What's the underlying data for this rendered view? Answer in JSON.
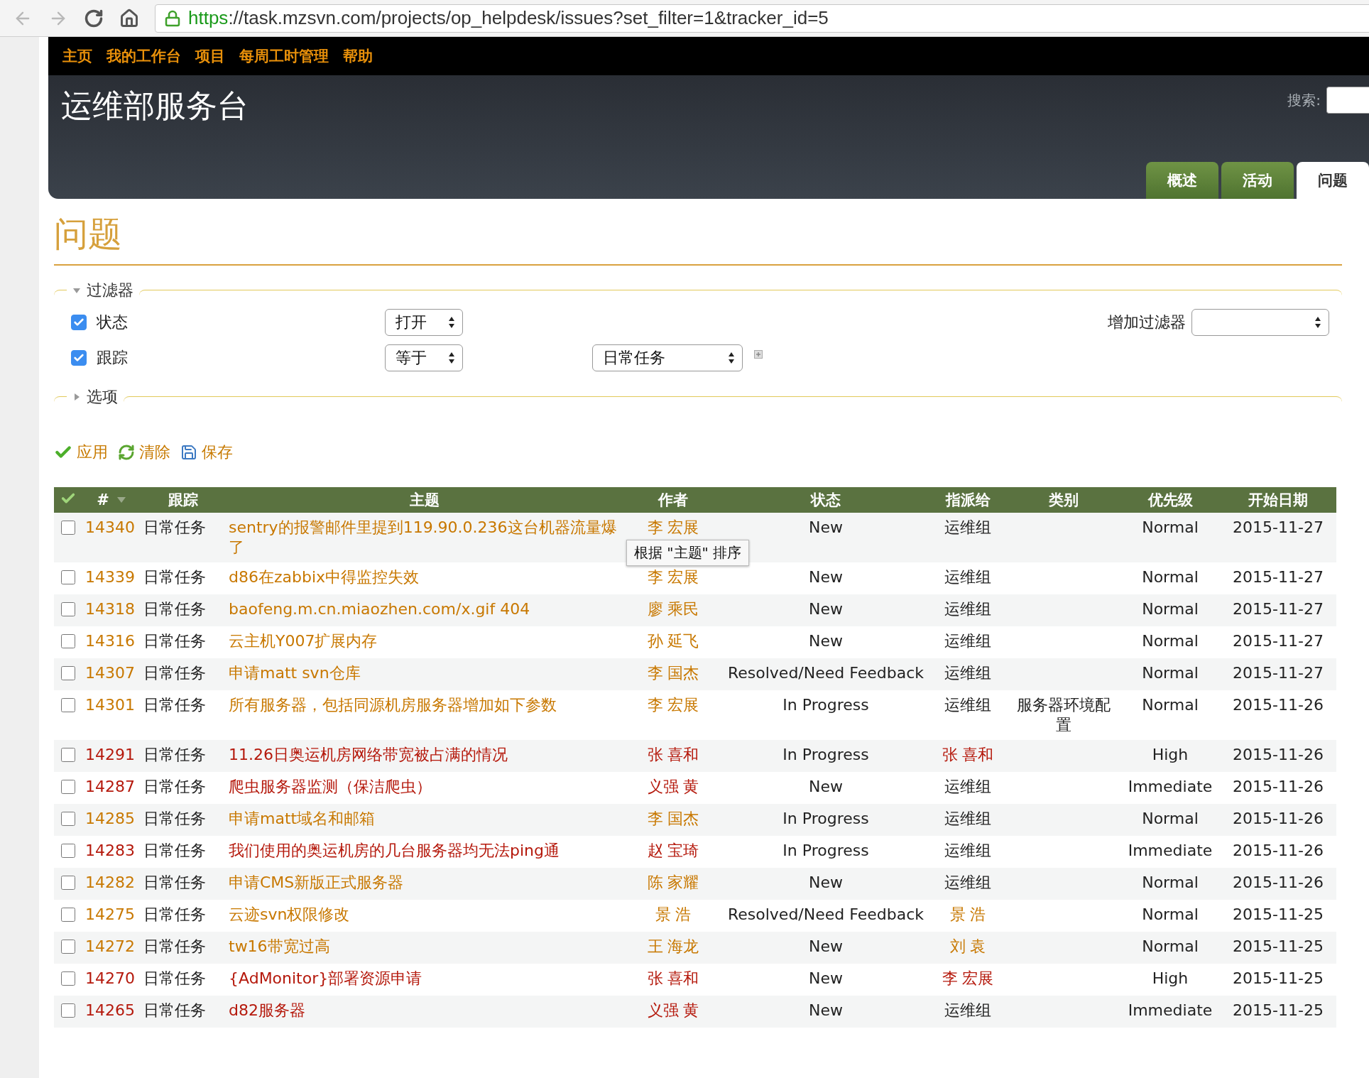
{
  "browser": {
    "url_scheme": "https",
    "url_rest": "://task.mzsvn.com/projects/op_helpdesk/issues?set_filter=1&tracker_id=5"
  },
  "top_menu": [
    "主页",
    "我的工作台",
    "项目",
    "每周工时管理",
    "帮助"
  ],
  "header": {
    "title": "运维部服务台",
    "search_label": "搜索:"
  },
  "tabs": [
    {
      "label": "概述",
      "selected": false
    },
    {
      "label": "活动",
      "selected": false
    },
    {
      "label": "问题",
      "selected": true
    }
  ],
  "page_title": "问题",
  "filters_legend": "过滤器",
  "filters_expanded": true,
  "filters": [
    {
      "label": "状态",
      "checked": true,
      "operator": "打开"
    },
    {
      "label": "跟踪",
      "checked": true,
      "operator": "等于",
      "value": "日常任务"
    }
  ],
  "add_filter_label": "增加过滤器",
  "options_legend": "选项",
  "options_expanded": false,
  "actions": [
    {
      "kind": "apply",
      "label": "应用"
    },
    {
      "kind": "clear",
      "label": "清除"
    },
    {
      "kind": "save",
      "label": "保存"
    }
  ],
  "table": {
    "columns": [
      "#",
      "跟踪",
      "主题",
      "作者",
      "状态",
      "指派给",
      "类别",
      "优先级",
      "开始日期"
    ],
    "rows": [
      {
        "id": "14340",
        "tracker": "日常任务",
        "subject": "sentry的报警邮件里提到119.90.0.236这台机器流量爆了",
        "author": "李 宏展",
        "status": "New",
        "assignee": "运维组",
        "assignee_link": false,
        "priority": "Normal",
        "urgent": false,
        "start": "2015-11-27",
        "checked": false
      },
      {
        "id": "14339",
        "tracker": "日常任务",
        "subject": "d86在zabbix中得监控失效",
        "author": "李 宏展",
        "status": "New",
        "assignee": "运维组",
        "assignee_link": false,
        "priority": "Normal",
        "urgent": false,
        "start": "2015-11-27",
        "checked": false
      },
      {
        "id": "14318",
        "tracker": "日常任务",
        "subject": "baofeng.m.cn.miaozhen.com/x.gif 404",
        "author": "廖 乘民",
        "status": "New",
        "assignee": "运维组",
        "assignee_link": false,
        "priority": "Normal",
        "urgent": false,
        "start": "2015-11-27",
        "checked": false
      },
      {
        "id": "14316",
        "tracker": "日常任务",
        "subject": "云主机Y007扩展内存",
        "author": "孙 延飞",
        "status": "New",
        "assignee": "运维组",
        "assignee_link": false,
        "priority": "Normal",
        "urgent": false,
        "start": "2015-11-27",
        "checked": false
      },
      {
        "id": "14307",
        "tracker": "日常任务",
        "subject": "申请matt svn仓库",
        "author": "李 国杰",
        "status": "Resolved/Need Feedback",
        "assignee": "运维组",
        "assignee_link": false,
        "priority": "Normal",
        "urgent": false,
        "start": "2015-11-27",
        "checked": false
      },
      {
        "id": "14301",
        "tracker": "日常任务",
        "subject": "所有服务器，包括同源机房服务器增加如下参数",
        "author": "李 宏展",
        "status": "In Progress",
        "assignee": "运维组",
        "assignee_link": false,
        "category": "服务器环境配置",
        "priority": "Normal",
        "urgent": false,
        "start": "2015-11-26",
        "checked": false
      },
      {
        "id": "14291",
        "tracker": "日常任务",
        "subject": "11.26日奥运机房网络带宽被占满的情况",
        "author": "张 喜和",
        "status": "In Progress",
        "assignee": "张 喜和",
        "assignee_link": true,
        "priority": "High",
        "urgent": true,
        "start": "2015-11-26",
        "checked": false
      },
      {
        "id": "14287",
        "tracker": "日常任务",
        "subject": "爬虫服务器监测（保洁爬虫）",
        "author": "义强 黄",
        "status": "New",
        "assignee": "运维组",
        "assignee_link": false,
        "priority": "Immediate",
        "urgent": true,
        "start": "2015-11-26",
        "checked": false
      },
      {
        "id": "14285",
        "tracker": "日常任务",
        "subject": "申请matt域名和邮箱",
        "author": "李 国杰",
        "status": "In Progress",
        "assignee": "运维组",
        "assignee_link": false,
        "priority": "Normal",
        "urgent": false,
        "start": "2015-11-26",
        "checked": false
      },
      {
        "id": "14283",
        "tracker": "日常任务",
        "subject": "我们使用的奥运机房的几台服务器均无法ping通",
        "author": "赵 宝琦",
        "status": "In Progress",
        "assignee": "运维组",
        "assignee_link": false,
        "priority": "Immediate",
        "urgent": true,
        "start": "2015-11-26",
        "checked": false
      },
      {
        "id": "14282",
        "tracker": "日常任务",
        "subject": "申请CMS新版正式服务器",
        "author": "陈 家耀",
        "status": "New",
        "assignee": "运维组",
        "assignee_link": false,
        "priority": "Normal",
        "urgent": false,
        "start": "2015-11-26",
        "checked": false
      },
      {
        "id": "14275",
        "tracker": "日常任务",
        "subject": "云迹svn权限修改",
        "author": "景 浩",
        "status": "Resolved/Need Feedback",
        "assignee": "景 浩",
        "assignee_link": true,
        "priority": "Normal",
        "urgent": false,
        "start": "2015-11-25",
        "checked": false
      },
      {
        "id": "14272",
        "tracker": "日常任务",
        "subject": "tw16带宽过高",
        "author": "王 海龙",
        "status": "New",
        "assignee": "刘 袁",
        "assignee_link": true,
        "priority": "Normal",
        "urgent": false,
        "start": "2015-11-25",
        "checked": false
      },
      {
        "id": "14270",
        "tracker": "日常任务",
        "subject": "{AdMonitor}部署资源申请",
        "author": "张 喜和",
        "status": "New",
        "assignee": "李 宏展",
        "assignee_link": true,
        "priority": "High",
        "urgent": true,
        "start": "2015-11-25",
        "checked": false
      },
      {
        "id": "14265",
        "tracker": "日常任务",
        "subject": "d82服务器",
        "author": "义强 黄",
        "status": "New",
        "assignee": "运维组",
        "assignee_link": false,
        "priority": "Immediate",
        "urgent": true,
        "start": "2015-11-25",
        "checked": false
      }
    ]
  },
  "tooltip": "根据 \"主题\" 排序"
}
